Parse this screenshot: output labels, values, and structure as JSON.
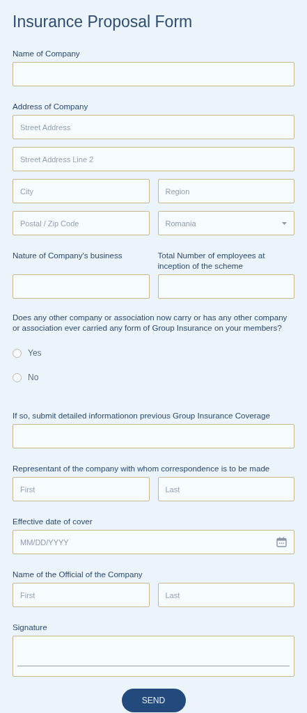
{
  "title": "Insurance Proposal Form",
  "sections": [
    {
      "kind": "fields",
      "label": "Name of Company",
      "rows": [
        [
          {
            "kind": "input"
          }
        ]
      ]
    },
    {
      "kind": "fields",
      "label": "Address of Company",
      "rows": [
        [
          {
            "kind": "input",
            "placeholder": "Street Address"
          }
        ],
        [
          {
            "kind": "input",
            "placeholder": "Street Address Line 2"
          }
        ],
        [
          {
            "kind": "input",
            "placeholder": "City"
          },
          {
            "kind": "input",
            "placeholder": "Region"
          }
        ],
        [
          {
            "kind": "input",
            "placeholder": "Postal / Zip Code"
          },
          {
            "kind": "select",
            "value": "Romania"
          }
        ]
      ]
    },
    {
      "kind": "pair",
      "columns": [
        {
          "label": "Nature of Company's business",
          "field": {
            "kind": "input"
          }
        },
        {
          "label": "Total Number of employees at inception of the scheme",
          "field": {
            "kind": "input"
          }
        }
      ]
    },
    {
      "kind": "radio",
      "label": "Does any other company or association now carry or has any other company or association ever carried any form of Group Insurance on your members?",
      "options": [
        {
          "label": "Yes",
          "selected": false
        },
        {
          "label": "No",
          "selected": false
        }
      ]
    },
    {
      "kind": "fields",
      "label": "If so, submit detailed informationon previous Group Insurance Coverage",
      "rows": [
        [
          {
            "kind": "input"
          }
        ]
      ]
    },
    {
      "kind": "fields",
      "label": "Representant of the company with whom correspondence is to be made",
      "rows": [
        [
          {
            "kind": "input",
            "placeholder": "First"
          },
          {
            "kind": "input",
            "placeholder": "Last"
          }
        ]
      ]
    },
    {
      "kind": "fields",
      "label": "Effective date of cover",
      "rows": [
        [
          {
            "kind": "date",
            "placeholder": "MM/DD/YYYY"
          }
        ]
      ]
    },
    {
      "kind": "fields",
      "label": "Name of the Official of the Company",
      "rows": [
        [
          {
            "kind": "input",
            "placeholder": "First"
          },
          {
            "kind": "input",
            "placeholder": "Last"
          }
        ]
      ]
    },
    {
      "kind": "signature",
      "label": "Signature"
    }
  ],
  "button": "SEND"
}
